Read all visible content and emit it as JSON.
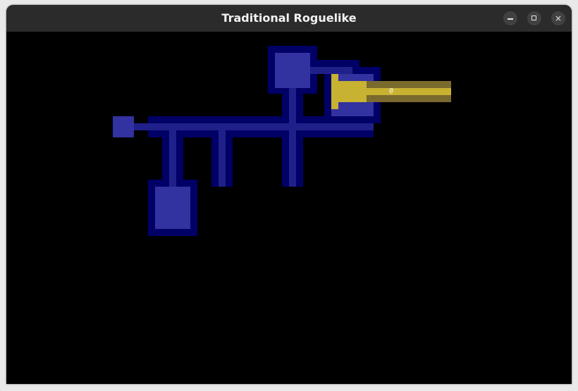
{
  "window": {
    "title": "Traditional Roguelike",
    "controls": {
      "minimize": "minimize",
      "maximize": "maximize",
      "close": "×"
    }
  },
  "map": {
    "player_glyph": "@",
    "colors": {
      "background": "#000000",
      "wall_dark": "#000066",
      "floor_explored": "#20208a",
      "room_lit": "#3232a0",
      "fov_dim": "#7a6a2e",
      "fov_bright": "#c8b232"
    }
  }
}
